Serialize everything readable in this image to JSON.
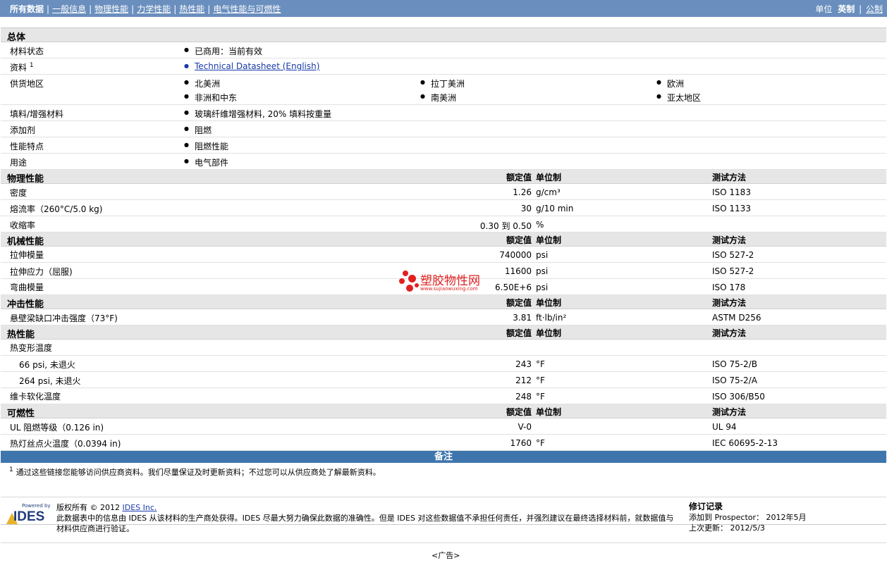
{
  "nav": {
    "items": [
      "所有数据",
      "一般信息",
      "物理性能",
      "力学性能",
      "热性能",
      "电气性能与可燃性"
    ],
    "sep": "|",
    "units_label": "单位",
    "unit_active": "英制",
    "unit_other": "公制"
  },
  "general": {
    "title": "总体",
    "material_status_label": "材料状态",
    "material_status": "已商用：当前有效",
    "resources_label": "资料",
    "resources_sup": "1",
    "datasheet_link": "Technical Datasheet (English)",
    "availability_label": "供货地区",
    "regions": [
      "北美洲",
      "拉丁美洲",
      "欧洲",
      "非洲和中东",
      "南美洲",
      "亚太地区"
    ],
    "filler_label": "填料/增强材料",
    "filler": "玻璃纤维增强材料, 20% 填料按重量",
    "additive_label": "添加剂",
    "additive": "阻燃",
    "features_label": "性能特点",
    "features": "阻燃性能",
    "uses_label": "用途",
    "uses": "电气部件"
  },
  "headers": {
    "nominal": "额定值",
    "unit": "单位制",
    "method": "测试方法"
  },
  "physical": {
    "title": "物理性能",
    "rows": [
      {
        "label": "密度",
        "value": "1.26",
        "unit": "g/cm³",
        "method": "ISO 1183"
      },
      {
        "label": "熔流率（260°C/5.0 kg)",
        "value": "30",
        "unit": "g/10 min",
        "method": "ISO 1133"
      },
      {
        "label": "收缩率",
        "value": "0.30 到  0.50",
        "unit": "%",
        "method": ""
      }
    ]
  },
  "mechanical": {
    "title": "机械性能",
    "rows": [
      {
        "label": "拉伸模量",
        "value": "740000",
        "unit": "psi",
        "method": "ISO 527-2"
      },
      {
        "label": "拉伸应力（屈服)",
        "value": "11600",
        "unit": "psi",
        "method": "ISO 527-2"
      },
      {
        "label": "弯曲模量",
        "value": "6.50E+6",
        "unit": "psi",
        "method": "ISO 178"
      }
    ]
  },
  "impact": {
    "title": "冲击性能",
    "rows": [
      {
        "label": "悬壁梁缺口冲击强度（73°F)",
        "value": "3.81",
        "unit": "ft·lb/in²",
        "method": "ASTM D256"
      }
    ]
  },
  "thermal": {
    "title": "热性能",
    "hdt_label": "热变形温度",
    "rows": [
      {
        "label": "66 psi, 未退火",
        "value": "243",
        "unit": "°F",
        "method": "ISO 75-2/B"
      },
      {
        "label": "264 psi, 未退火",
        "value": "212",
        "unit": "°F",
        "method": "ISO 75-2/A"
      },
      {
        "label": "维卡软化温度",
        "value": "248",
        "unit": "°F",
        "method": "ISO 306/B50"
      }
    ]
  },
  "flammability": {
    "title": "可燃性",
    "rows": [
      {
        "label": "UL 阻燃等级（0.126 in)",
        "value": "V-0",
        "unit": "",
        "method": "UL 94"
      },
      {
        "label": "热灯丝点火温度（0.0394 in)",
        "value": "1760",
        "unit": "°F",
        "method": "IEC 60695-2-13"
      }
    ]
  },
  "notes": {
    "title": "备注",
    "sup": "1",
    "text": "通过这些链接您能够访问供应商资料。我们尽量保证及时更新资料；不过您可以从供应商处了解最新资料。"
  },
  "footer": {
    "powered_by": "Powered by",
    "logo_text": "IDES",
    "copyright": "版权所有 © 2012",
    "copyright_link": "IDES Inc.",
    "disclaimer": "此数据表中的信息由 IDES 从该材料的生产商处获得。IDES 尽最大努力确保此数据的准确性。但是 IDES 对这些数据值不承担任何责任，并强烈建议在最终选择材料前，就数据值与材料供应商进行验证。",
    "rev_title": "修订记录",
    "added": "添加到 Prospector：  2012年5月",
    "updated": "上次更新：  2012/5/3"
  },
  "ad": "<广告>",
  "watermark": {
    "title": "塑胶物性网",
    "url": "www.sujiaowuxing.com"
  },
  "colors": {
    "topbar": "#6a8fbe",
    "notes_bar": "#3e75ad",
    "section_bg": "#e6e6e6",
    "watermark": "#e02020"
  }
}
